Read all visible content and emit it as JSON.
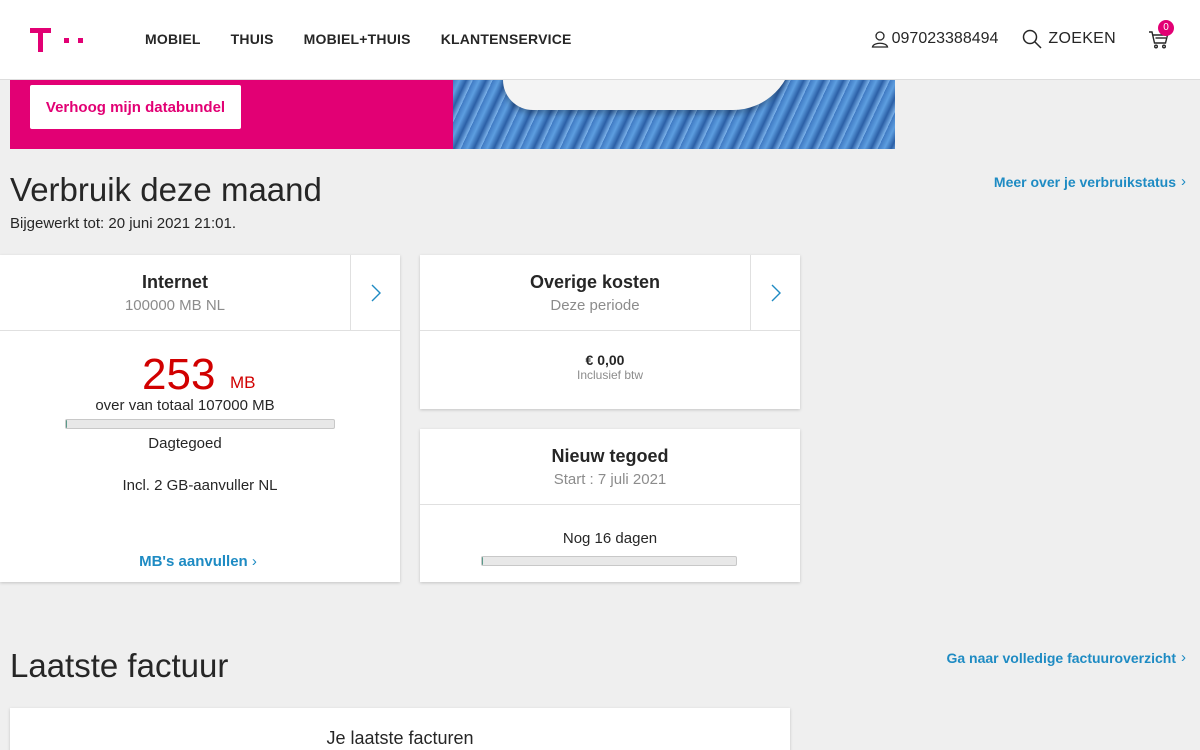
{
  "header": {
    "nav": [
      "MOBIEL",
      "THUIS",
      "MOBIEL+THUIS",
      "KLANTENSERVICE"
    ],
    "phone": "097023388494",
    "search_label": "ZOEKEN",
    "cart_count": "0"
  },
  "banner": {
    "button_label": "Verhoog mijn databundel"
  },
  "usage": {
    "title": "Verbruik deze maand",
    "updated": "Bijgewerkt tot: 20 juni 2021 21:01.",
    "more_link": "Meer over je verbruikstatus"
  },
  "internet_card": {
    "title": "Internet",
    "subtitle": "100000 MB NL",
    "remaining_value": "253",
    "remaining_unit": "MB",
    "remaining_text": "over van totaal 107000 MB",
    "remaining_fraction": 0.0024,
    "daily_label": "Dagtegoed",
    "addon": "Incl. 2 GB-aanvuller NL",
    "link": "MB's aanvullen"
  },
  "other_costs_card": {
    "title": "Overige kosten",
    "subtitle": "Deze periode",
    "amount": "€ 0,00",
    "vat_note": "Inclusief btw"
  },
  "new_credit_card": {
    "title": "Nieuw tegoed",
    "subtitle": "Start : 7 juli 2021",
    "days_left": "Nog 16 dagen",
    "progress_fraction": 0.005
  },
  "invoice": {
    "title": "Laatste factuur",
    "overview_link": "Ga naar volledige factuuroverzicht",
    "card_title": "Je laatste facturen"
  },
  "colors": {
    "brand": "#e20074",
    "link": "#1e8bc3",
    "alert": "#d10000"
  }
}
